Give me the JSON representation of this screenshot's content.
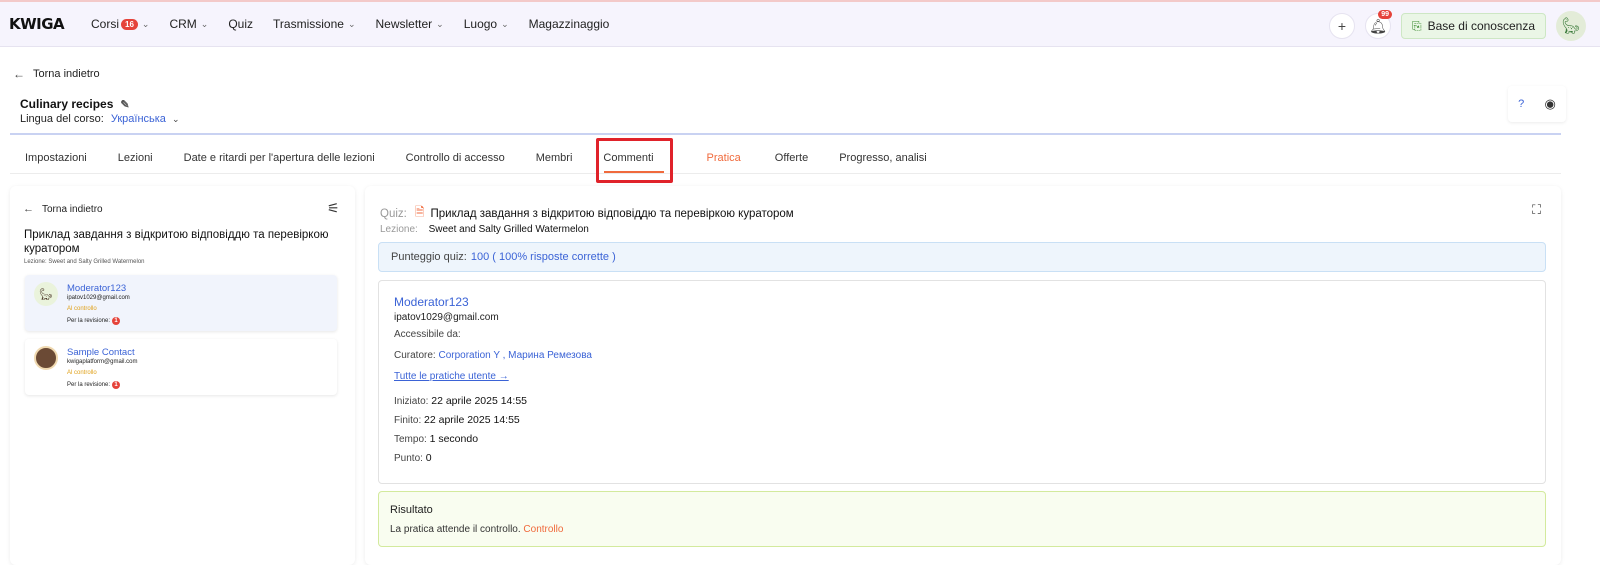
{
  "app": {
    "logo": "KWIGA"
  },
  "topnav": {
    "items": [
      {
        "label": "Corsi",
        "badge": "16",
        "chevron": true
      },
      {
        "label": "CRM",
        "chevron": true
      },
      {
        "label": "Quiz",
        "chevron": false
      },
      {
        "label": "Trasmissione",
        "chevron": true
      },
      {
        "label": "Newsletter",
        "chevron": true
      },
      {
        "label": "Luogo",
        "chevron": true
      },
      {
        "label": "Magazzinaggio",
        "chevron": false
      }
    ],
    "plus_icon": "+",
    "bell_badge": "99",
    "kb_label": "Base di conoscenza"
  },
  "page": {
    "back_label": "Torna indietro",
    "course_title": "Culinary recipes",
    "lang_label": "Lingua del corso:",
    "lang_value": "Українська",
    "help_label": "?"
  },
  "tabs": [
    {
      "label": "Impostazioni",
      "active": false
    },
    {
      "label": "Lezioni",
      "active": false
    },
    {
      "label": "Date e ritardi per l'apertura delle lezioni",
      "active": false
    },
    {
      "label": "Controllo di accesso",
      "active": false
    },
    {
      "label": "Membri",
      "active": false
    },
    {
      "label": "Commenti",
      "active": false
    },
    {
      "label": "Pratica",
      "active": true
    },
    {
      "label": "Offerte",
      "active": false
    },
    {
      "label": "Progresso, analisi",
      "active": false
    }
  ],
  "left": {
    "back_label": "Torna indietro",
    "title": "Приклад завдання з відкритою відповіддю та перевіркою куратором",
    "lesson": "Lezione: Sweet and Salty Grilled Watermelon",
    "cards": [
      {
        "name": "Moderator123",
        "email": "ipatov1029@gmail.com",
        "status": "Al controllo",
        "review_label": "Per la revisione:",
        "review_count": "1"
      },
      {
        "name": "Sample Contact",
        "email": "kwigaplatform@gmail.com",
        "status": "Al controllo",
        "review_label": "Per la revisione:",
        "review_count": "1"
      }
    ]
  },
  "right": {
    "quiz_label": "Quiz:",
    "quiz_value": "Приклад завдання з відкритою відповіддю та перевіркою куратором",
    "lesson_label": "Lezione:",
    "lesson_value": "Sweet and Salty Grilled Watermelon",
    "score_label": "Punteggio quiz:",
    "score_value": "100 ( 100% risposte corrette )",
    "user": {
      "name": "Moderator123",
      "email": "ipatov1029@gmail.com",
      "access_label": "Accessibile da:",
      "curator_label": "Curatore:",
      "curator_value": "Corporation Y , Марина Ремезова",
      "all_link": "Tutte le pratiche utente →",
      "started_label": "Iniziato:",
      "started_value": "22 aprile 2025 14:55",
      "finished_label": "Finito:",
      "finished_value": "22 aprile 2025 14:55",
      "time_label": "Tempo:",
      "time_value": "1 secondo",
      "points_label": "Punto:",
      "points_value": "0"
    },
    "result": {
      "title": "Risultato",
      "text": "La pratica attende il controllo.",
      "link": "Controllo"
    }
  },
  "colors": {
    "accent": "#f06a3c",
    "link": "#3b63d6",
    "highlight": "#e0222a"
  }
}
